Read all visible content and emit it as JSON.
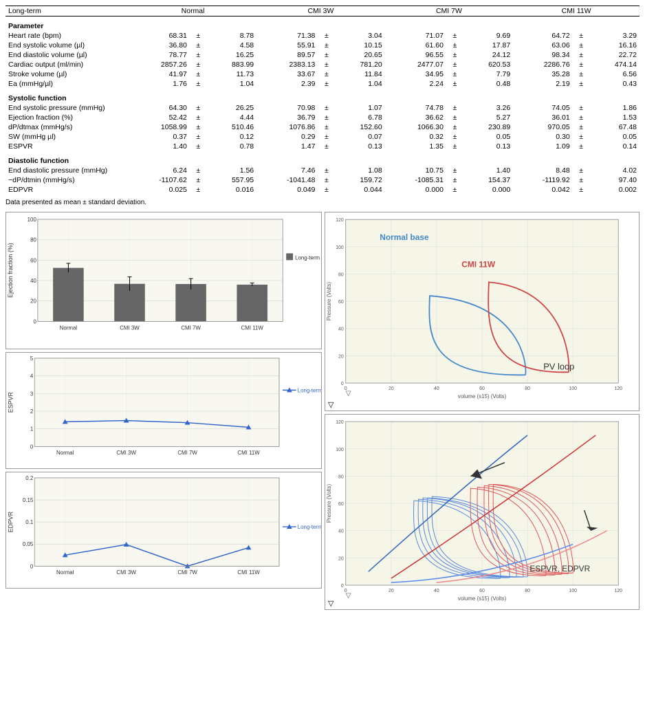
{
  "title": "Long-term",
  "columns": [
    "Normal",
    "CMI 3W",
    "CMI 7W",
    "CMI 11W"
  ],
  "sections": [
    {
      "name": "Parameter",
      "rows": [
        {
          "label": "Heart rate (bpm)",
          "values": [
            [
              "68.31",
              "±",
              "8.78"
            ],
            [
              "71.38",
              "±",
              "3.04"
            ],
            [
              "71.07",
              "±",
              "9.69"
            ],
            [
              "64.72",
              "±",
              "3.29"
            ]
          ]
        },
        {
          "label": "End systolic volume (µl)",
          "values": [
            [
              "36.80",
              "±",
              "4.58"
            ],
            [
              "55.91",
              "±",
              "10.15"
            ],
            [
              "61.60",
              "±",
              "17.87"
            ],
            [
              "63.06",
              "±",
              "16.16"
            ]
          ]
        },
        {
          "label": "End diastolic volume (µl)",
          "values": [
            [
              "78.77",
              "±",
              "16.25"
            ],
            [
              "89.57",
              "±",
              "20.65"
            ],
            [
              "96.55",
              "±",
              "24.12"
            ],
            [
              "98.34",
              "±",
              "22.72"
            ]
          ]
        },
        {
          "label": "Cardiac output (ml/min)",
          "values": [
            [
              "2857.26",
              "±",
              "883.99"
            ],
            [
              "2383.13",
              "±",
              "781.20"
            ],
            [
              "2477.07",
              "±",
              "620.53"
            ],
            [
              "2286.76",
              "±",
              "474.14"
            ]
          ]
        },
        {
          "label": "Stroke volume (µl)",
          "values": [
            [
              "41.97",
              "±",
              "11.73"
            ],
            [
              "33.67",
              "±",
              "11.84"
            ],
            [
              "34.95",
              "±",
              "7.79"
            ],
            [
              "35.28",
              "±",
              "6.56"
            ]
          ]
        },
        {
          "label": "Ea (mmHg/µl)",
          "values": [
            [
              "1.76",
              "±",
              "1.04"
            ],
            [
              "2.39",
              "±",
              "1.04"
            ],
            [
              "2.24",
              "±",
              "0.48"
            ],
            [
              "2.19",
              "±",
              "0.43"
            ]
          ]
        }
      ]
    },
    {
      "name": "Systolic function",
      "rows": [
        {
          "label": "End systolic pressure (mmHg)",
          "values": [
            [
              "64.30",
              "±",
              "26.25"
            ],
            [
              "70.98",
              "±",
              "1.07"
            ],
            [
              "74.78",
              "±",
              "3.26"
            ],
            [
              "74.05",
              "±",
              "1.86"
            ]
          ]
        },
        {
          "label": "Ejection fraction (%)",
          "values": [
            [
              "52.42",
              "±",
              "4.44"
            ],
            [
              "36.79",
              "±",
              "6.78"
            ],
            [
              "36.62",
              "±",
              "5.27"
            ],
            [
              "36.01",
              "±",
              "1.53"
            ]
          ]
        },
        {
          "label": "dP/dtmax (mmHg/s)",
          "values": [
            [
              "1058.99",
              "±",
              "510.46"
            ],
            [
              "1076.86",
              "±",
              "152.60"
            ],
            [
              "1066.30",
              "±",
              "230.89"
            ],
            [
              "970.05",
              "±",
              "67.48"
            ]
          ]
        },
        {
          "label": "SW (mmHg µl)",
          "values": [
            [
              "0.37",
              "±",
              "0.12"
            ],
            [
              "0.29",
              "±",
              "0.07"
            ],
            [
              "0.32",
              "±",
              "0.05"
            ],
            [
              "0.30",
              "±",
              "0.05"
            ]
          ]
        },
        {
          "label": "ESPVR",
          "values": [
            [
              "1.40",
              "±",
              "0.78"
            ],
            [
              "1.47",
              "±",
              "0.13"
            ],
            [
              "1.35",
              "±",
              "0.13"
            ],
            [
              "1.09",
              "±",
              "0.14"
            ]
          ]
        }
      ]
    },
    {
      "name": "Diastolic function",
      "rows": [
        {
          "label": "End diastolic pressure (mmHg)",
          "values": [
            [
              "6.24",
              "±",
              "1.56"
            ],
            [
              "7.46",
              "±",
              "1.08"
            ],
            [
              "10.75",
              "±",
              "1.40"
            ],
            [
              "8.48",
              "±",
              "4.02"
            ]
          ]
        },
        {
          "label": "−dP/dtmin (mmHg/s)",
          "values": [
            [
              "-1107.62",
              "±",
              "557.95"
            ],
            [
              "-1041.48",
              "±",
              "159.72"
            ],
            [
              "-1085.31",
              "±",
              "154.37"
            ],
            [
              "-1119.92",
              "±",
              "97.40"
            ]
          ]
        },
        {
          "label": "EDPVR",
          "values": [
            [
              "0.025",
              "±",
              "0.016"
            ],
            [
              "0.049",
              "±",
              "0.044"
            ],
            [
              "0.000",
              "±",
              "0.000"
            ],
            [
              "0.042",
              "±",
              "0.002"
            ]
          ]
        }
      ]
    }
  ],
  "data_note": "Data presented as mean ± standard deviation.",
  "charts": {
    "ejection_fraction": {
      "title": "Ejection fraction (%)",
      "legend": "Long-term",
      "y_label": "Ejection fraction (%)",
      "y_max": 100,
      "y_min": 0,
      "y_ticks": [
        0,
        20,
        40,
        60,
        80,
        100
      ],
      "bars": [
        {
          "label": "Normal",
          "value": 52.42,
          "error": 4.44
        },
        {
          "label": "CMI 3W",
          "value": 36.79,
          "error": 6.78
        },
        {
          "label": "CMI 7W",
          "value": 36.62,
          "error": 5.27
        },
        {
          "label": "CMI 11W",
          "value": 36.01,
          "error": 1.53
        }
      ]
    },
    "espvr": {
      "title": "ESPVR",
      "legend": "Long-term",
      "y_label": "ESPVR",
      "y_max": 5,
      "y_min": 0,
      "y_ticks": [
        0,
        1,
        2,
        3,
        4,
        5
      ],
      "points": [
        {
          "label": "Normal",
          "value": 1.4
        },
        {
          "label": "CMI 3W",
          "value": 1.47
        },
        {
          "label": "CMI 7W",
          "value": 1.35
        },
        {
          "label": "CMI 11W",
          "value": 1.09
        }
      ]
    },
    "edpvr": {
      "title": "EDPVR",
      "legend": "Long-term",
      "y_label": "EDPVR",
      "y_max": 0.2,
      "y_min": 0,
      "y_ticks": [
        0,
        0.05,
        0.1,
        0.15,
        0.2
      ],
      "points": [
        {
          "label": "Normal",
          "value": 0.025
        },
        {
          "label": "CMI 3W",
          "value": 0.049
        },
        {
          "label": "CMI 7W",
          "value": 0.0
        },
        {
          "label": "CMI 11W",
          "value": 0.042
        }
      ]
    },
    "pv_loop": {
      "label_normal": "Normal base",
      "label_cmi": "CMI 11W",
      "label_chart": "PV loop",
      "x_label": "volume (s15) (Volts)",
      "y_label": "Pressure (Volts)",
      "x_max": 120,
      "y_max": 120
    },
    "espvr_edpvr": {
      "label_chart": "ESPVR, EDPVR",
      "x_label": "volume (s15) (Volts)",
      "y_label": "Pressure (Volts)",
      "x_max": 120,
      "y_max": 120
    }
  },
  "nav_icon": "▽"
}
